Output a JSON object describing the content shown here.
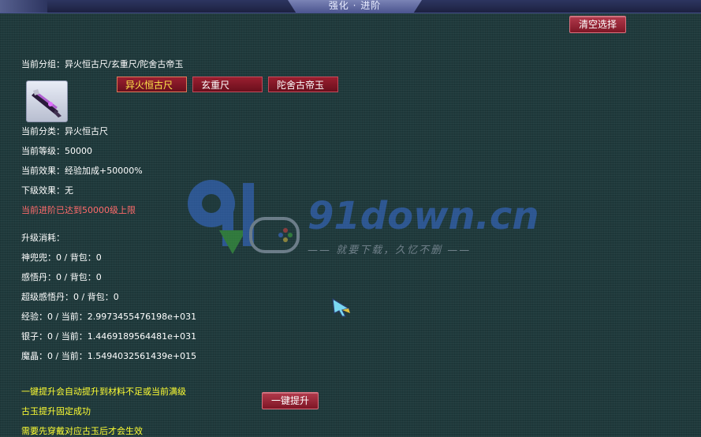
{
  "window": {
    "title": "强化 · 进阶"
  },
  "toolbar": {
    "clear_label": "清空选择"
  },
  "group": {
    "label": "当前分组：异火恒古尺/玄重尺/陀舍古帝玉",
    "buttons": [
      "异火恒古尺",
      "玄重尺",
      "陀舍古帝玉"
    ],
    "selected_index": 0
  },
  "item": {
    "icon": "sword-item-icon"
  },
  "info": {
    "category": "当前分类：异火恒古尺",
    "level": "当前等级：50000",
    "effect": "当前效果：经验加成+50000%",
    "next_effect": "下级效果：无",
    "max_notice": "当前进阶已达到50000级上限"
  },
  "cost": {
    "title": "升级消耗：",
    "lines": [
      "神兜兜：0 / 背包：0",
      "感悟丹：0 / 背包：0",
      "超级感悟丹：0 / 背包：0",
      "经验：0 / 当前：2.9973455476198e+031",
      "银子：0 / 当前：1.4469189564481e+031",
      "魔晶：0 / 当前：1.5494032561439e+015"
    ]
  },
  "notes": [
    "一键提升会自动提升到材料不足或当前满级",
    "古玉提升固定成功",
    "需要先穿戴对应古玉后才会生效"
  ],
  "actions": {
    "upgrade_label": "一键提升"
  },
  "watermark": {
    "site": "91down.cn",
    "slogan": "—— 就要下载，久忆不删 ——"
  },
  "colors": {
    "accent_red": "#8a1a2a",
    "notice_red": "#ff6b6b",
    "note_yellow": "#ffff33"
  }
}
